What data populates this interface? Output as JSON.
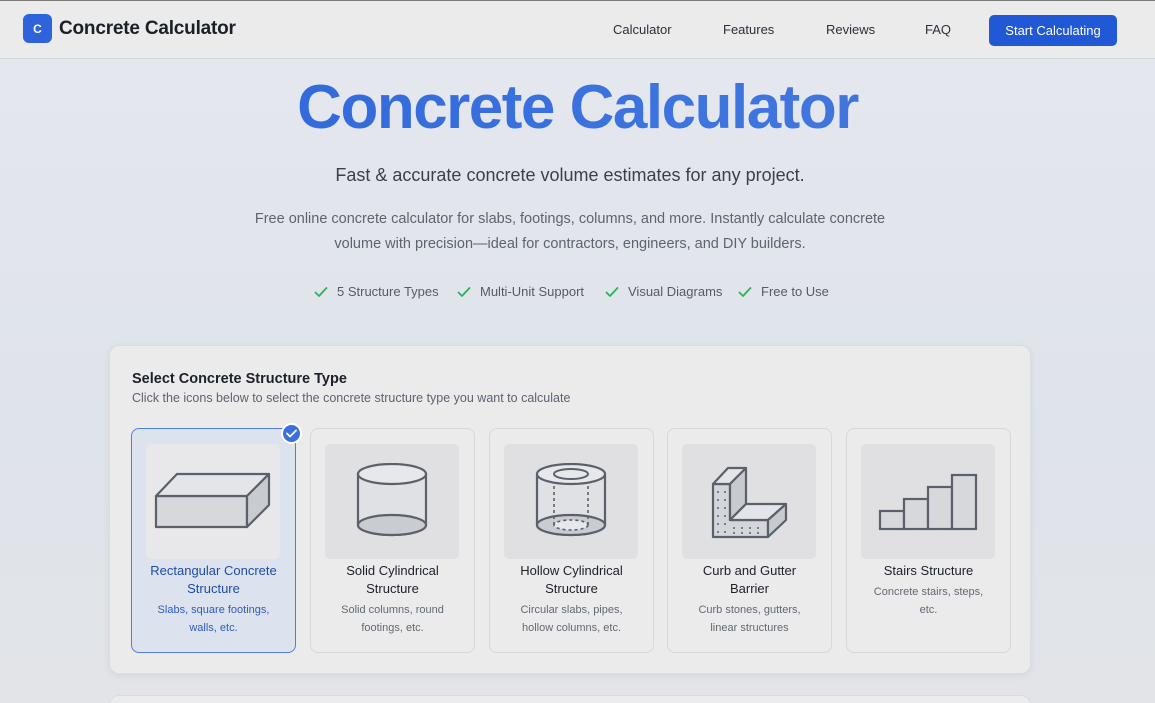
{
  "header": {
    "logo_letter": "C",
    "brand": "Concrete Calculator",
    "nav": [
      "Calculator",
      "Features",
      "Reviews",
      "FAQ"
    ],
    "cta": "Start Calculating"
  },
  "hero": {
    "title": "Concrete Calculator",
    "subtitle": "Fast & accurate concrete volume estimates for any project.",
    "description_line1": "Free online concrete calculator for slabs, footings, columns, and more. Instantly calculate concrete",
    "description_line2": "volume with precision—ideal for contractors, engineers, and DIY builders.",
    "features": [
      "5 Structure Types",
      "Multi-Unit Support",
      "Visual Diagrams",
      "Free to Use"
    ]
  },
  "selector": {
    "title": "Select Concrete Structure Type",
    "description": "Click the icons below to select the concrete structure type you want to calculate",
    "options": [
      {
        "title_line1": "Rectangular Concrete",
        "title_line2": "Structure",
        "desc_line1": "Slabs, square footings,",
        "desc_line2": "walls, etc.",
        "icon": "rectangular-block-icon",
        "selected": true
      },
      {
        "title_line1": "Solid Cylindrical",
        "title_line2": "Structure",
        "desc_line1": "Solid columns, round",
        "desc_line2": "footings, etc.",
        "icon": "solid-cylinder-icon",
        "selected": false
      },
      {
        "title_line1": "Hollow Cylindrical",
        "title_line2": "Structure",
        "desc_line1": "Circular slabs, pipes,",
        "desc_line2": "hollow columns, etc.",
        "icon": "hollow-cylinder-icon",
        "selected": false
      },
      {
        "title_line1": "Curb and Gutter",
        "title_line2": "Barrier",
        "desc_line1": "Curb stones, gutters,",
        "desc_line2": "linear structures",
        "icon": "curb-gutter-icon",
        "selected": false
      },
      {
        "title_line1": "Stairs Structure",
        "title_line2": "",
        "desc_line1": "Concrete stairs, steps,",
        "desc_line2": "etc.",
        "icon": "stairs-icon",
        "selected": false
      }
    ]
  },
  "colors": {
    "accent": "#2158d6",
    "check_green": "#2bb35a",
    "selected_bg": "#dce3ee"
  }
}
